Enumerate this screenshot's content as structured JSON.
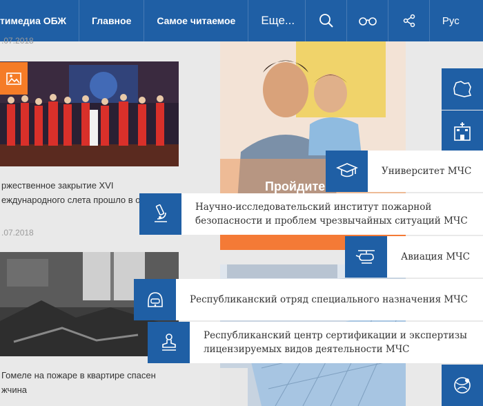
{
  "nav": {
    "items": [
      "тимедиа ОБЖ",
      "Главное",
      "Самое читаемое",
      "Еще..."
    ],
    "icons": [
      "search-icon",
      "glasses-icon",
      "share-icon"
    ],
    "lang": "Рус"
  },
  "news": [
    {
      "date": ".07.2018",
      "title": "ржественное закрытие XVI еждународного слета прошло в омеле."
    },
    {
      "date": ".07.2018",
      "title": "Гомеле на пожаре в квартире спасен жчина"
    }
  ],
  "promo": {
    "text": "Пройдите"
  },
  "sidebar": {
    "icons": [
      "belarus-map-icon",
      "hospital-icon",
      "globe-icon"
    ]
  },
  "menu": [
    {
      "icon": "graduation-cap-icon",
      "label": "Университет МЧС"
    },
    {
      "icon": "microscope-icon",
      "label": "Научно-исследовательский институт пожарной безопасности и проблем чрезвычайных ситуаций МЧС"
    },
    {
      "icon": "helicopter-icon",
      "label": "Авиация МЧС"
    },
    {
      "icon": "helmet-icon",
      "label": "Республиканский отряд специального назначения МЧС"
    },
    {
      "icon": "stamp-icon",
      "label": "Республиканский центр сертификации и экспертизы лицензируемых видов деятельности МЧС"
    }
  ]
}
